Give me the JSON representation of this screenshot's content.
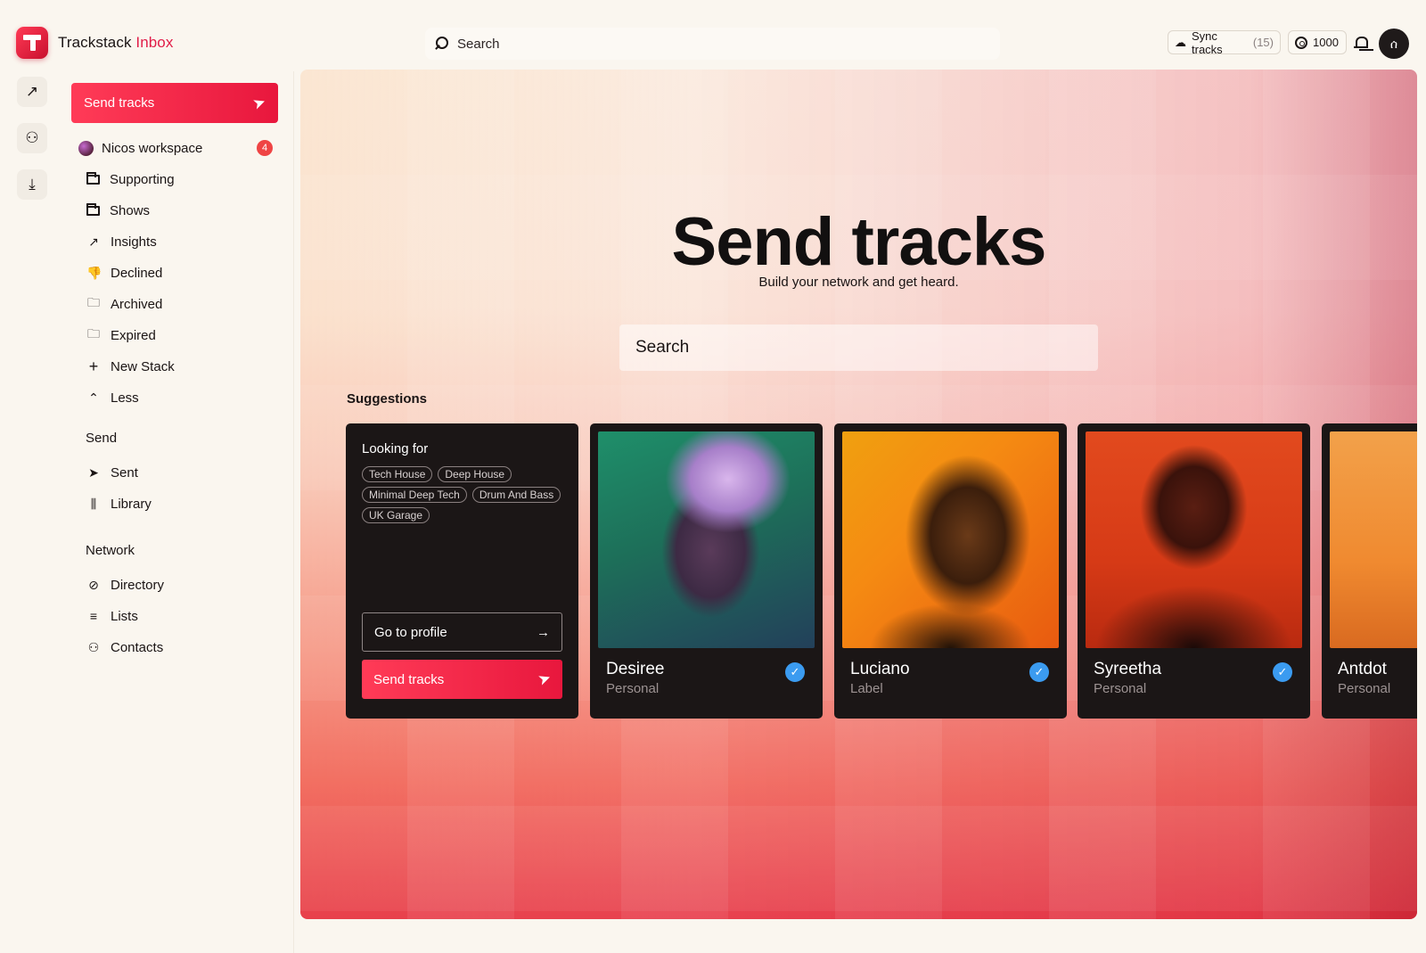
{
  "app": {
    "brand_name": "Trackstack",
    "brand_section": "Inbox"
  },
  "topbar": {
    "search_placeholder": "Search",
    "sync_label": "Sync tracks",
    "sync_count": "(15)",
    "credits": "1000",
    "avatar_glyph": "ሰ"
  },
  "sidebar": {
    "send_button": "Send tracks",
    "workspace_name": "Nicos workspace",
    "workspace_badge": "4",
    "items": [
      {
        "label": "Supporting",
        "icon": "folder-icon"
      },
      {
        "label": "Shows",
        "icon": "folder-icon"
      },
      {
        "label": "Insights",
        "icon": "trend-up-icon"
      },
      {
        "label": "Declined",
        "icon": "thumbs-down-icon"
      },
      {
        "label": "Archived",
        "icon": "archive-icon"
      },
      {
        "label": "Expired",
        "icon": "expired-icon"
      },
      {
        "label": "New Stack",
        "icon": "plus-icon"
      },
      {
        "label": "Less",
        "icon": "chevron-up-icon"
      }
    ],
    "send_section": {
      "title": "Send",
      "items": [
        {
          "label": "Sent",
          "icon": "paper-plane-icon"
        },
        {
          "label": "Library",
          "icon": "library-icon"
        }
      ]
    },
    "network_section": {
      "title": "Network",
      "items": [
        {
          "label": "Directory",
          "icon": "compass-icon"
        },
        {
          "label": "Lists",
          "icon": "list-icon"
        },
        {
          "label": "Contacts",
          "icon": "contacts-icon"
        }
      ]
    }
  },
  "main": {
    "title": "Send tracks",
    "subtitle": "Build your network and get heard.",
    "search_placeholder": "Search",
    "suggestions_label": "Suggestions",
    "looking_for": {
      "title": "Looking for",
      "tags": [
        "Tech House",
        "Deep House",
        "Minimal Deep Tech",
        "Drum And Bass",
        "UK Garage"
      ],
      "profile_button": "Go to profile",
      "send_button": "Send tracks"
    },
    "cards": [
      {
        "name": "Desiree",
        "role": "Personal"
      },
      {
        "name": "Luciano",
        "role": "Label"
      },
      {
        "name": "Syreetha",
        "role": "Personal"
      },
      {
        "name": "Antdot",
        "role": "Personal"
      }
    ]
  },
  "colors": {
    "accent": "#e8173d",
    "verified": "#3b9bf0",
    "card_bg": "#1b1616"
  }
}
